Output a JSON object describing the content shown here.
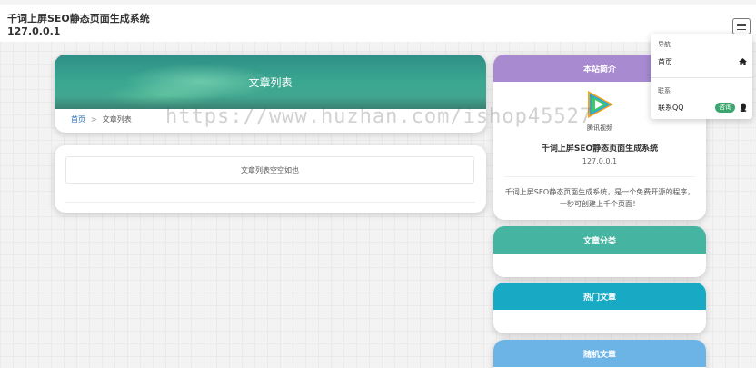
{
  "header": {
    "site_title": "千词上屏SEO静态页面生成系统",
    "host": "127.0.0.1",
    "menu_icon": "menu-icon"
  },
  "main": {
    "list_title": "文章列表",
    "breadcrumb": {
      "home": "首页",
      "separator": ">",
      "current": "文章列表"
    },
    "empty_text": "文章列表空空如也"
  },
  "sidebar": {
    "about": {
      "title": "本站简介",
      "logo_label": "腾讯视频",
      "site_name": "千词上屏SEO静态页面生成系统",
      "host": "127.0.0.1",
      "description": "千词上屏SEO静态页面生成系统，是一个免费开源的程序，一秒可创建上千个页面！"
    },
    "categories": {
      "title": "文章分类"
    },
    "hot": {
      "title": "热门文章"
    },
    "random": {
      "title": "随机文章"
    }
  },
  "dropdown": {
    "nav_section": "导航",
    "home_label": "首页",
    "contact_section": "联系",
    "qq_label": "联系QQ",
    "qq_badge": "咨询"
  },
  "watermark": "https://www.huzhan.com/ishop45527",
  "colors": {
    "about_head": "#a78ad0",
    "categories_head": "#45b4a1",
    "hot_head": "#18a9c4",
    "random_head": "#6cb3e6",
    "banner": "#3aa791",
    "badge": "#3aa86e"
  }
}
